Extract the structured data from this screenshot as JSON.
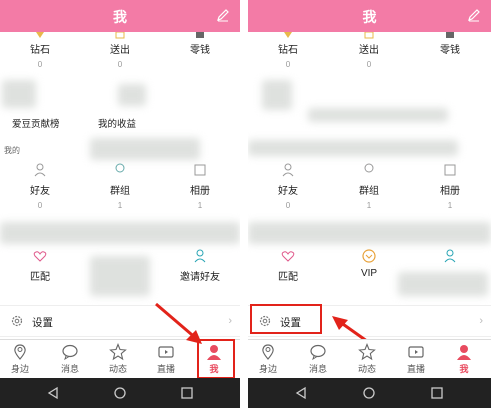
{
  "header": {
    "title": "我"
  },
  "stats": [
    {
      "label": "钻石",
      "value": "0"
    },
    {
      "label": "送出",
      "value": "0"
    },
    {
      "label": "零钱",
      "value": ""
    }
  ],
  "links": {
    "left": "爱豆贡献榜",
    "mid": "我的收益"
  },
  "section": {
    "mine": "我的"
  },
  "social": [
    {
      "label": "好友",
      "value": "0"
    },
    {
      "label": "群组",
      "value": "1"
    },
    {
      "label": "相册",
      "value": "1"
    }
  ],
  "extras_left": [
    {
      "label": "匹配"
    },
    {
      "label": "邀请好友"
    }
  ],
  "extras_right": [
    {
      "label": "匹配"
    },
    {
      "label": "VIP"
    }
  ],
  "settings": {
    "label": "设置"
  },
  "tabs": [
    {
      "label": "身边",
      "icon": "location-icon"
    },
    {
      "label": "消息",
      "icon": "chat-icon"
    },
    {
      "label": "动态",
      "icon": "star-icon"
    },
    {
      "label": "直播",
      "icon": "video-icon"
    },
    {
      "label": "我",
      "icon": "person-icon"
    }
  ],
  "colors": {
    "header": "#f37ba6",
    "accent": "#e84b5f",
    "highlight": "#e2231a"
  }
}
